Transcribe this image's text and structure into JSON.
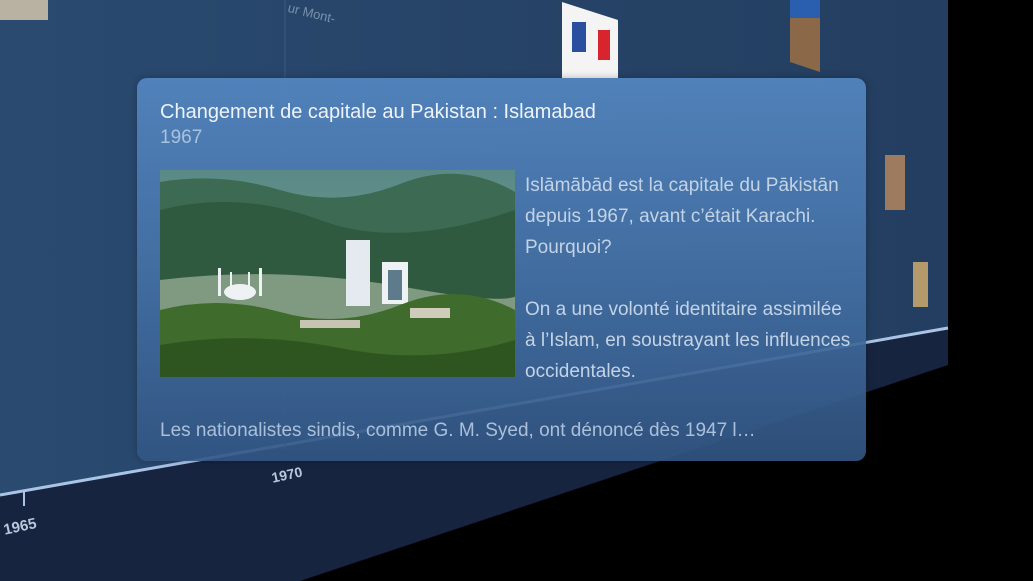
{
  "card": {
    "title": "Changement de capitale au Pakistan : Islamabad",
    "year": "1967",
    "image_alt": "Vue d'Islamabad avec la mosquée Faisal et les montagnes",
    "paragraphs": [
      "Islāmābād est la capitale du Pākistān depuis 1967, avant c’était Karachi. Pourquoi?",
      "On a une volonté identitaire assimilée à l’Islam, en soustrayant les influences occidentales."
    ],
    "excerpt": "Les nationalistes sindis, comme G. M. Syed, ont dénoncé dès 1947 l…"
  },
  "timeline": {
    "ticks": [
      "1965",
      "1970"
    ],
    "background_fragment": "ur Mont-"
  },
  "colors": {
    "wall": "#2b4a6e",
    "floor": "#172440",
    "card": "#4a77a8"
  }
}
